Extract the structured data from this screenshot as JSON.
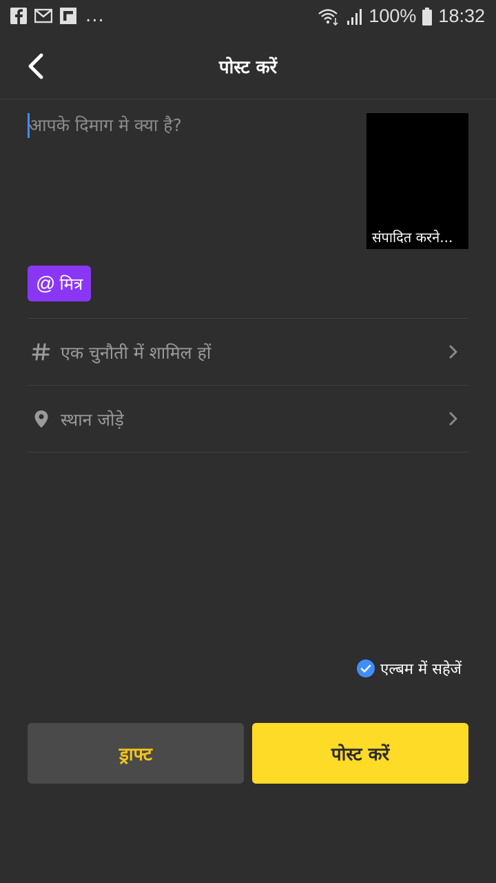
{
  "status_bar": {
    "battery_percent": "100%",
    "time": "18:32",
    "more_indicator": "...",
    "left_icons": [
      "facebook-icon",
      "gmail-icon",
      "flipboard-icon"
    ],
    "right_icons": [
      "wifi-icon",
      "signal-icon",
      "battery-icon"
    ]
  },
  "header": {
    "title": "पोस्ट करें",
    "back_icon": "chevron-left-icon"
  },
  "compose": {
    "placeholder": "आपके दिमाग मे क्या है?",
    "value": "",
    "thumbnail_label": "संपादित करने..."
  },
  "mention": {
    "symbol": "@",
    "label": "मित्र"
  },
  "rows": [
    {
      "icon": "hashtag-icon",
      "label": "एक चुनौती में शामिल हों"
    },
    {
      "icon": "location-pin-icon",
      "label": "स्थान जोड़े"
    }
  ],
  "save_album": {
    "label": "एल्बम में सहेजें",
    "checked": true
  },
  "buttons": {
    "draft_label": "ड्राफ्ट",
    "post_label": "पोस्ट करें"
  },
  "colors": {
    "background": "#2e2e2e",
    "accent_yellow": "#fedb26",
    "draft_text": "#f5c518",
    "mention_purple": "#8a37f5",
    "check_blue": "#3f8dff"
  }
}
